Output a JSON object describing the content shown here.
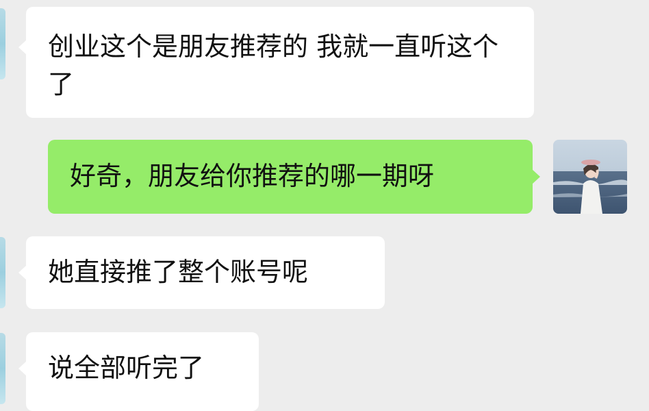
{
  "messages": [
    {
      "side": "received",
      "text": "创业这个是朋友推荐的 我就一直听这个了"
    },
    {
      "side": "sent",
      "text": "好奇，朋友给你推荐的哪一期呀"
    },
    {
      "side": "received",
      "text": "她直接推了整个账号呢"
    },
    {
      "side": "received",
      "text": "说全部听完了"
    }
  ],
  "colors": {
    "background": "#ededed",
    "received_bubble": "#ffffff",
    "sent_bubble": "#95ec69",
    "text": "#111111"
  },
  "icons": {
    "self_avatar": "user-avatar-photo",
    "contact_avatar": "contact-avatar-photo"
  }
}
